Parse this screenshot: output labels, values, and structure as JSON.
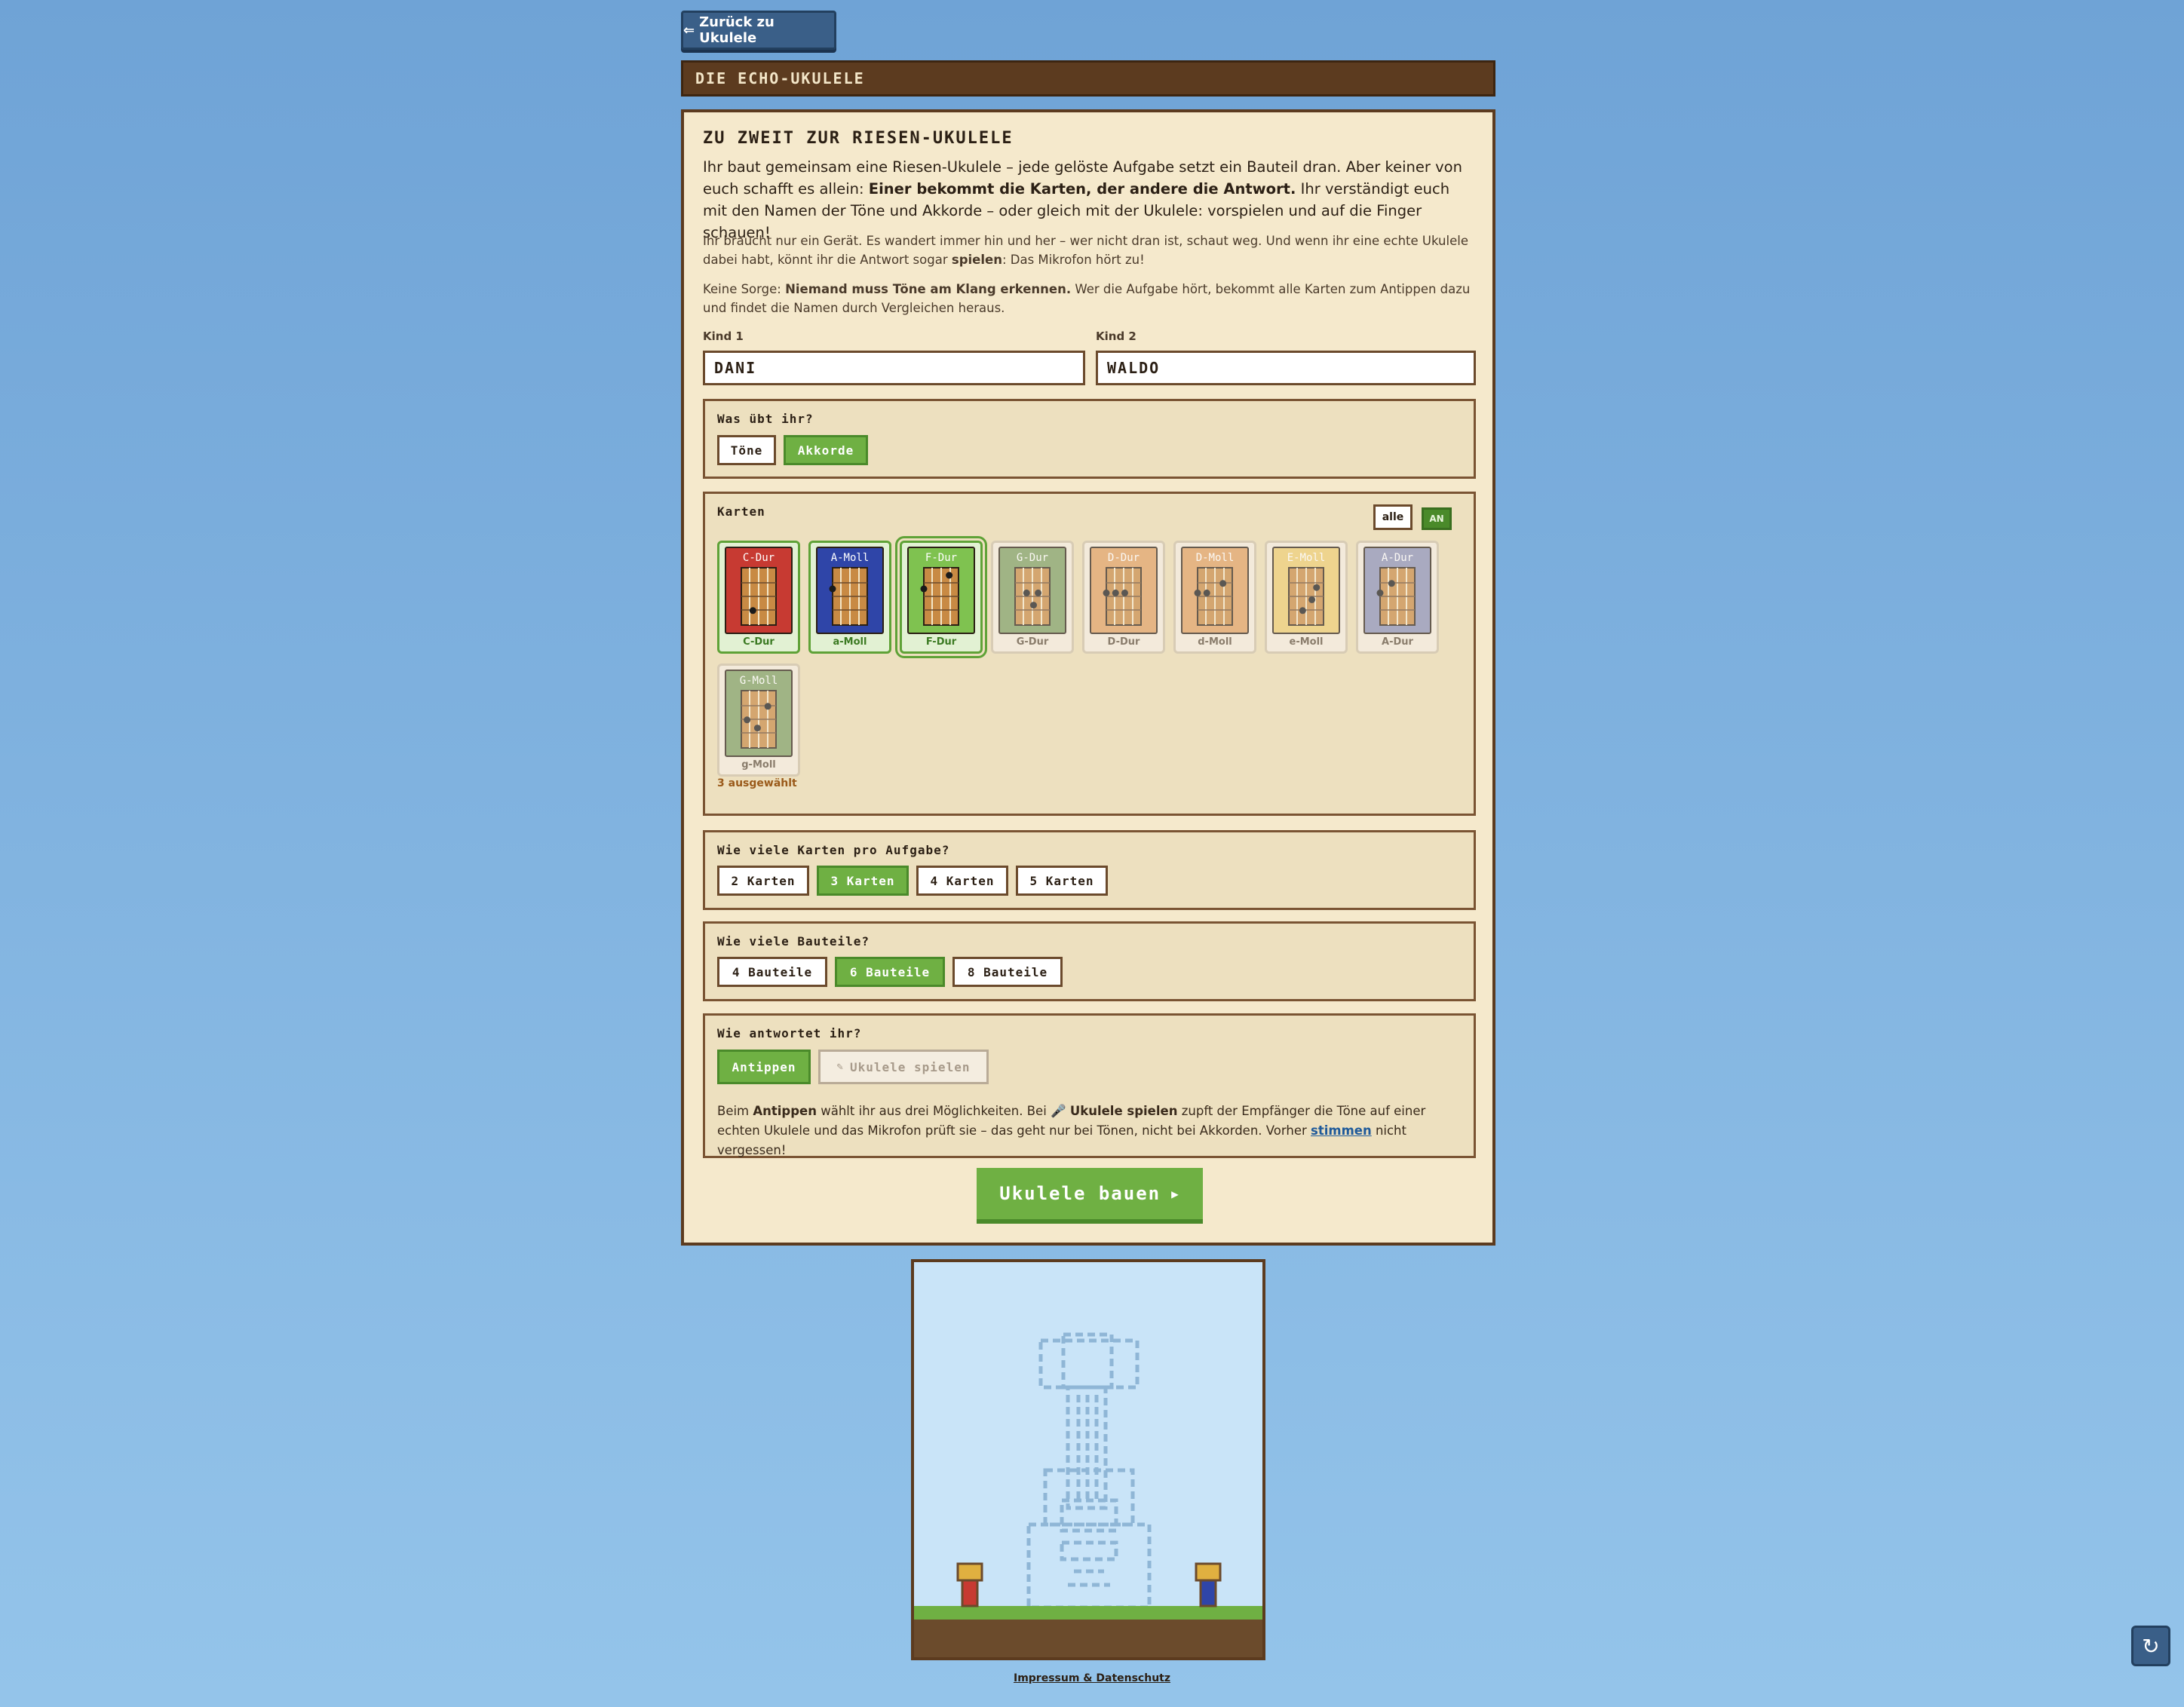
{
  "back_button": {
    "label": "Zurück zu Ukulele",
    "icon": "arrow-left-icon"
  },
  "header": {
    "title": "DIE ECHO-UKULELE"
  },
  "panel": {
    "title": "ZU ZWEIT ZUR RIESEN-UKULELE",
    "intro_a": "Ihr baut gemeinsam eine Riesen-Ukulele – jede gelöste Aufgabe setzt ein Bauteil dran. Aber keiner von euch schafft es allein: ",
    "intro_b": "Einer bekommt die Karten, der andere die Antwort.",
    "intro_c": " Ihr verständigt euch mit den Namen der Töne und Akkorde – oder gleich mit der Ukulele: vorspielen und auf die Finger schauen!",
    "note1_a": "Ihr braucht nur ein Gerät. Es wandert immer hin und her – wer nicht dran ist, schaut weg. Und wenn ihr eine echte Ukulele dabei habt, könnt ihr die Antwort sogar ",
    "note1_b": "spielen",
    "note1_c": ": Das Mikrofon hört zu!",
    "note2_a": "Keine Sorge: ",
    "note2_b": "Niemand muss Töne am Klang erkennen.",
    "note2_c": " Wer die Aufgabe hört, bekommt alle Karten zum Antippen dazu und findet die Namen durch Vergleichen heraus."
  },
  "players": {
    "kid1_label": "Kind 1",
    "kid1_value": "DANI",
    "kid2_label": "Kind 2",
    "kid2_value": "WALDO"
  },
  "practice": {
    "title": "Was übt ihr?",
    "options": [
      "Töne",
      "Akkorde"
    ],
    "selected": "Akkorde"
  },
  "cards": {
    "title": "Karten",
    "all_label": "alle",
    "toggle_label": "AN",
    "selected_count_text": "3 ausgewählt",
    "items": [
      {
        "name": "C-Dur",
        "label": "C-Dur",
        "color": "#c73a32",
        "selected": true
      },
      {
        "name": "A-Moll",
        "label": "a-Moll",
        "color": "#2f45a8",
        "selected": true
      },
      {
        "name": "F-Dur",
        "label": "F-Dur",
        "color": "#7fc250",
        "selected": true
      },
      {
        "name": "G-Dur",
        "label": "G-Dur",
        "color": "#7d9e62",
        "selected": false
      },
      {
        "name": "D-Dur",
        "label": "D-Dur",
        "color": "#e0a060",
        "selected": false
      },
      {
        "name": "D-Moll",
        "label": "d-Moll",
        "color": "#e0a060",
        "selected": false
      },
      {
        "name": "E-Moll",
        "label": "e-Moll",
        "color": "#eccb6e",
        "selected": false
      },
      {
        "name": "A-Dur",
        "label": "A-Dur",
        "color": "#8a8fb6",
        "selected": false
      },
      {
        "name": "G-Moll",
        "label": "g-Moll",
        "color": "#7d9e62",
        "selected": false
      }
    ]
  },
  "per_task": {
    "title": "Wie viele Karten pro Aufgabe?",
    "options": [
      "2 Karten",
      "3 Karten",
      "4 Karten",
      "5 Karten"
    ],
    "selected": "3 Karten"
  },
  "parts": {
    "title": "Wie viele Bauteile?",
    "options": [
      "4 Bauteile",
      "6 Bauteile",
      "8 Bauteile"
    ],
    "selected": "6 Bauteile"
  },
  "answer": {
    "title": "Wie antwortet ihr?",
    "tap_label": "Antippen",
    "play_label": "Ukulele spielen",
    "help_1": "Beim ",
    "help_2": "Antippen",
    "help_3": " wählt ihr aus drei Möglichkeiten. Bei ",
    "help_4": "Ukulele spielen",
    "help_5": " zupft der Empfänger die Töne auf einer echten Ukulele und das Mikrofon prüft sie – das geht nur bei Tönen, nicht bei Akkorden. Vorher ",
    "help_link": "stimmen",
    "help_6": " nicht vergessen!"
  },
  "build_button": {
    "label": "Ukulele bauen",
    "icon": "play-triangle-icon"
  },
  "footer": {
    "link": "Impressum & Datenschutz"
  },
  "colors": {
    "accent_green": "#6fb043",
    "brown": "#5c3b1f",
    "panel_bg": "#f5e9cc"
  }
}
